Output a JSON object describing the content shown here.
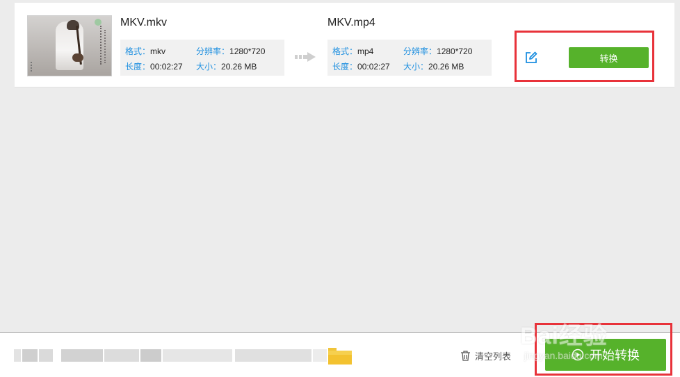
{
  "task": {
    "source": {
      "name": "MKV.mkv",
      "format_label": "格式：",
      "format": "mkv",
      "resolution_label": "分辨率：",
      "resolution": "1280*720",
      "duration_label": "长度：",
      "duration": "00:02:27",
      "size_label": "大小：",
      "size": "20.26 MB"
    },
    "output": {
      "name": "MKV.mp4",
      "format_label": "格式：",
      "format": "mp4",
      "resolution_label": "分辨率：",
      "resolution": "1280*720",
      "duration_label": "长度：",
      "duration": "00:02:27",
      "size_label": "大小：",
      "size": "20.26 MB"
    },
    "convert_label": "转换"
  },
  "bottom_bar": {
    "clear_list_label": "清空列表",
    "start_label": "开始转换"
  },
  "watermark": {
    "brand": "Bai经验",
    "url": "jingyan.baidu.com"
  },
  "icons": {
    "edit": "edit-icon",
    "arrow": "arrow-right-icon",
    "trash": "trash-icon",
    "play": "play-circle-icon",
    "folder": "folder-icon"
  },
  "colors": {
    "accent_green": "#56b22b",
    "label_blue": "#1d8fe0",
    "highlight_red": "#e8323a"
  }
}
